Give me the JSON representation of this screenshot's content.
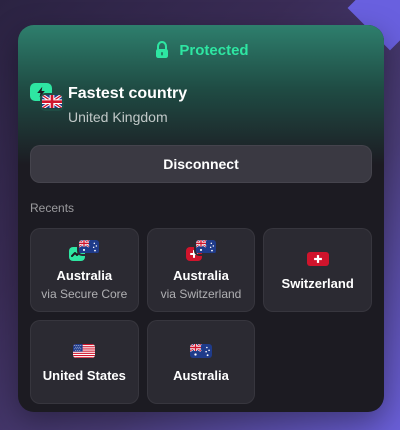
{
  "status": {
    "text": "Protected",
    "icon": "lock-icon",
    "color": "#2ee6a2"
  },
  "connection": {
    "title": "Fastest country",
    "subtitle": "United Kingdom",
    "icons": [
      "bolt-icon",
      "uk-flag-icon"
    ]
  },
  "actions": {
    "disconnect": "Disconnect"
  },
  "recents": {
    "label": "Recents",
    "items": [
      {
        "name": "Australia",
        "sub": "via Secure Core",
        "icon": "secure-core-australia-flag-icon"
      },
      {
        "name": "Australia",
        "sub": "via Switzerland",
        "icon": "switzerland-australia-flag-icon"
      },
      {
        "name": "Switzerland",
        "sub": "",
        "icon": "switzerland-flag-icon"
      },
      {
        "name": "United States",
        "sub": "",
        "icon": "us-flag-icon"
      },
      {
        "name": "Australia",
        "sub": "",
        "icon": "australia-flag-icon"
      }
    ]
  },
  "colors": {
    "accent_green": "#2ee6a2",
    "panel_bg": "#1c1b22",
    "card_bg": "#2b2a32",
    "button_bg": "#3a3942",
    "corner_accent": "#6b63e6"
  }
}
